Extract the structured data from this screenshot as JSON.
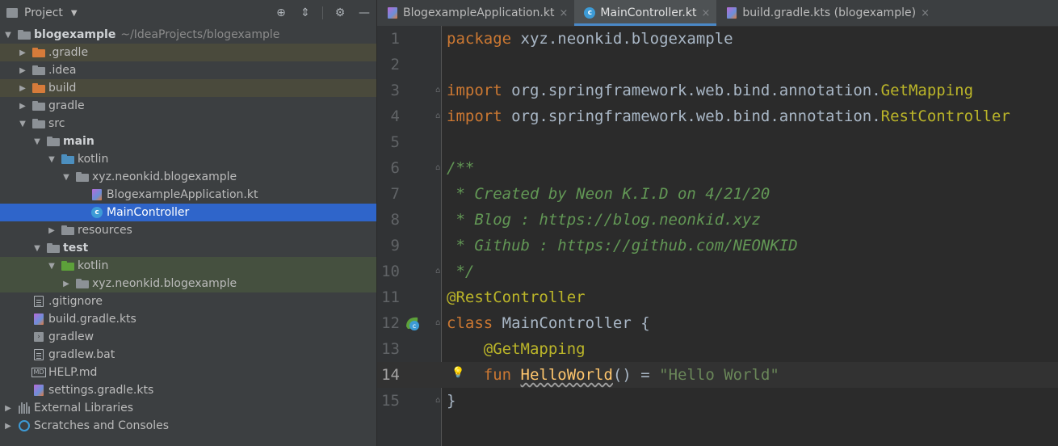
{
  "project_panel": {
    "title": "Project",
    "tree": [
      {
        "label": "blogexample",
        "path": "~/IdeaProjects/blogexample",
        "indent": 0,
        "arrow": "down",
        "icon": "folder-gray",
        "bold": true,
        "bg": "",
        "name": "tree-item-blogexample"
      },
      {
        "label": ".gradle",
        "indent": 1,
        "arrow": "right",
        "icon": "folder-orange",
        "bg": "excluded",
        "name": "tree-item-gradle-hidden"
      },
      {
        "label": ".idea",
        "indent": 1,
        "arrow": "right",
        "icon": "folder-gray",
        "bg": "",
        "name": "tree-item-idea"
      },
      {
        "label": "build",
        "indent": 1,
        "arrow": "right",
        "icon": "folder-orange",
        "bg": "excluded",
        "name": "tree-item-build"
      },
      {
        "label": "gradle",
        "indent": 1,
        "arrow": "right",
        "icon": "folder-gray",
        "bg": "",
        "name": "tree-item-gradle"
      },
      {
        "label": "src",
        "indent": 1,
        "arrow": "down",
        "icon": "folder-gray",
        "bg": "",
        "name": "tree-item-src"
      },
      {
        "label": "main",
        "indent": 2,
        "arrow": "down",
        "icon": "folder-gray",
        "bold": true,
        "bg": "",
        "name": "tree-item-main"
      },
      {
        "label": "kotlin",
        "indent": 3,
        "arrow": "down",
        "icon": "folder-blue",
        "bg": "",
        "name": "tree-item-kotlin-main"
      },
      {
        "label": "xyz.neonkid.blogexample",
        "indent": 4,
        "arrow": "down",
        "icon": "package",
        "bg": "",
        "name": "tree-item-package-main"
      },
      {
        "label": "BlogexampleApplication.kt",
        "indent": 5,
        "arrow": "none",
        "icon": "kotlin-file",
        "bg": "",
        "name": "tree-item-blogexample-application"
      },
      {
        "label": "MainController",
        "indent": 5,
        "arrow": "none",
        "icon": "controller-class",
        "bg": "selected",
        "name": "tree-item-main-controller"
      },
      {
        "label": "resources",
        "indent": 3,
        "arrow": "right",
        "icon": "folder-gray",
        "bg": "",
        "name": "tree-item-resources"
      },
      {
        "label": "test",
        "indent": 2,
        "arrow": "down",
        "icon": "folder-gray",
        "bold": true,
        "bg": "",
        "name": "tree-item-test"
      },
      {
        "label": "kotlin",
        "indent": 3,
        "arrow": "down",
        "icon": "folder-green",
        "bg": "testbg",
        "name": "tree-item-kotlin-test"
      },
      {
        "label": "xyz.neonkid.blogexample",
        "indent": 4,
        "arrow": "right",
        "icon": "package",
        "bg": "testbg",
        "name": "tree-item-package-test"
      },
      {
        "label": ".gitignore",
        "indent": 1,
        "arrow": "none",
        "icon": "file",
        "bg": "",
        "name": "tree-item-gitignore"
      },
      {
        "label": "build.gradle.kts",
        "indent": 1,
        "arrow": "none",
        "icon": "kotlin-file",
        "bg": "",
        "name": "tree-item-build-gradle-kts"
      },
      {
        "label": "gradlew",
        "indent": 1,
        "arrow": "none",
        "icon": "terminal-file",
        "bg": "",
        "name": "tree-item-gradlew"
      },
      {
        "label": "gradlew.bat",
        "indent": 1,
        "arrow": "none",
        "icon": "file",
        "bg": "",
        "name": "tree-item-gradlew-bat"
      },
      {
        "label": "HELP.md",
        "indent": 1,
        "arrow": "none",
        "icon": "markdown-file",
        "bg": "",
        "name": "tree-item-help-md"
      },
      {
        "label": "settings.gradle.kts",
        "indent": 1,
        "arrow": "none",
        "icon": "kotlin-file",
        "bg": "",
        "name": "tree-item-settings-gradle-kts"
      },
      {
        "label": "External Libraries",
        "indent": 0,
        "arrow": "right",
        "icon": "library",
        "bg": "",
        "name": "tree-item-external-libraries"
      },
      {
        "label": "Scratches and Consoles",
        "indent": 0,
        "arrow": "right",
        "icon": "scratch",
        "bg": "",
        "name": "tree-item-scratches"
      }
    ]
  },
  "tabs": [
    {
      "label": "BlogexampleApplication.kt",
      "active": false,
      "icon": "kotlin-file",
      "name": "tab-blogexample-application"
    },
    {
      "label": "MainController.kt",
      "active": true,
      "icon": "controller-class",
      "name": "tab-main-controller"
    },
    {
      "label": "build.gradle.kts (blogexample)",
      "active": false,
      "icon": "kotlin-file",
      "name": "tab-build-gradle-kts"
    }
  ],
  "code_lines": [
    {
      "n": "1",
      "tokens": [
        [
          "kw",
          "package "
        ],
        [
          "",
          "xyz.neonkid.blogexample"
        ]
      ]
    },
    {
      "n": "2",
      "tokens": []
    },
    {
      "n": "3",
      "fold": true,
      "tokens": [
        [
          "kw",
          "import "
        ],
        [
          "",
          "org.springframework.web.bind.annotation."
        ],
        [
          "ann",
          "GetMapping"
        ]
      ]
    },
    {
      "n": "4",
      "fold": true,
      "tokens": [
        [
          "kw",
          "import "
        ],
        [
          "",
          "org.springframework.web.bind.annotation."
        ],
        [
          "ann",
          "RestController"
        ]
      ]
    },
    {
      "n": "5",
      "tokens": []
    },
    {
      "n": "6",
      "fold": true,
      "tokens": [
        [
          "cm",
          "/**"
        ]
      ]
    },
    {
      "n": "7",
      "tokens": [
        [
          "cm",
          " * Created by Neon K.I.D on 4/21/20"
        ]
      ]
    },
    {
      "n": "8",
      "tokens": [
        [
          "cm",
          " * Blog : https://blog.neonkid.xyz"
        ]
      ]
    },
    {
      "n": "9",
      "tokens": [
        [
          "cm",
          " * Github : https://github.com/NEONKID"
        ]
      ]
    },
    {
      "n": "10",
      "fold": true,
      "tokens": [
        [
          "cm",
          " */"
        ]
      ]
    },
    {
      "n": "11",
      "tokens": [
        [
          "ann",
          "@RestController"
        ]
      ]
    },
    {
      "n": "12",
      "fold": true,
      "gutter_icon": "spring-controller",
      "tokens": [
        [
          "kw",
          "class "
        ],
        [
          "",
          "MainController {"
        ]
      ]
    },
    {
      "n": "13",
      "tokens": [
        [
          "",
          "    "
        ],
        [
          "ann",
          "@GetMapping"
        ]
      ]
    },
    {
      "n": "14",
      "current": true,
      "bulb": true,
      "tokens": [
        [
          "",
          "    "
        ],
        [
          "kw",
          "fun "
        ],
        [
          "fn",
          "HelloWorld"
        ],
        [
          "",
          "() = "
        ],
        [
          "str",
          "\"Hello World\""
        ]
      ]
    },
    {
      "n": "15",
      "fold": true,
      "tokens": [
        [
          "",
          "}"
        ]
      ]
    }
  ],
  "colors": {
    "selection": "#2f65ca",
    "keyword": "#cc7832",
    "annotation": "#bbb529",
    "comment": "#629755",
    "string": "#6a8759",
    "function": "#ffc66d"
  }
}
